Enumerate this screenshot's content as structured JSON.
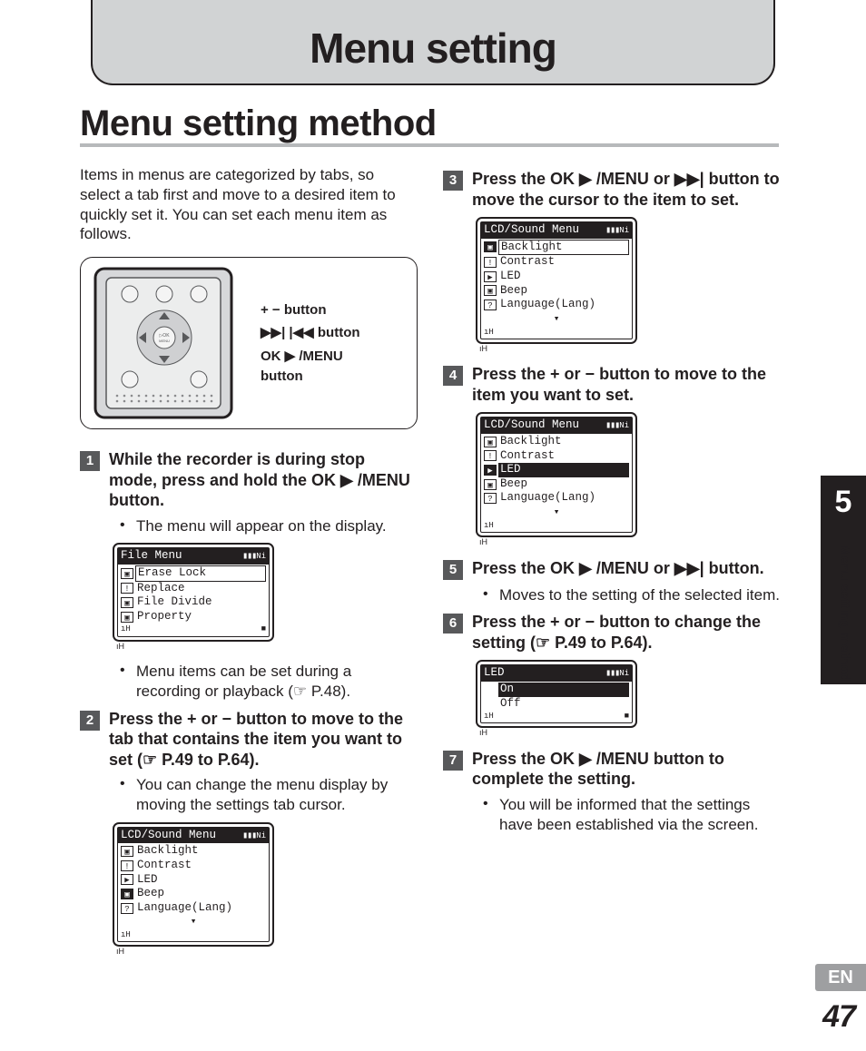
{
  "header": {
    "title": "Menu setting"
  },
  "section_title": "Menu setting method",
  "intro": "Items in menus are categorized by tabs, so select a tab first and move to a desired item to quickly set it. You can set each menu item as follows.",
  "device_labels": {
    "l1a": "+ −",
    "l1b": " button",
    "l2a": "▶▶| |◀◀",
    "l2b": " button",
    "l3a": "OK ▶ /MENU",
    "l3b": "button"
  },
  "steps": {
    "s1": {
      "num": "1",
      "text_a": "While the recorder is during stop mode, press and hold the ",
      "text_b": "OK ▶ /MENU",
      "text_c": " button."
    },
    "s1_b1": "The menu will appear on the display.",
    "s1_b2": "Menu items can be set during a recording or playback (☞ P.48).",
    "s2": {
      "num": "2",
      "text": "Press the + or − button to move to the tab that contains the item you want to set (☞ P.49 to P.64)."
    },
    "s2_b1": "You can change the menu display by moving the settings tab cursor.",
    "s3": {
      "num": "3",
      "text_a": "Press the ",
      "text_b": "OK ▶ /MENU",
      "text_c": " or ",
      "text_d": "▶▶|",
      "text_e": " button to move the cursor to the item to set."
    },
    "s4": {
      "num": "4",
      "text": "Press the + or − button to move to the item you want to set."
    },
    "s5": {
      "num": "5",
      "text_a": "Press the ",
      "text_b": "OK ▶ /MENU",
      "text_c": " or ",
      "text_d": "▶▶|",
      "text_e": " button."
    },
    "s5_b1": "Moves to the setting of the selected item.",
    "s6": {
      "num": "6",
      "text": "Press the + or − button to change the setting (☞ P.49 to P.64)."
    },
    "s7": {
      "num": "7",
      "text_a": "Press the ",
      "text_b": "OK ▶ /MENU",
      "text_c": " button to complete the setting."
    },
    "s7_b1": "You will be informed that the settings have been established via the screen."
  },
  "lcd": {
    "file_menu": {
      "title": "File Menu",
      "rows": [
        {
          "icon": "▣",
          "label": "Erase Lock",
          "mode": "boxed"
        },
        {
          "icon": "!",
          "label": "Replace",
          "mode": ""
        },
        {
          "icon": "▣",
          "label": "File Divide",
          "mode": ""
        },
        {
          "icon": "▣",
          "label": "Property",
          "mode": ""
        }
      ]
    },
    "lcd_sound_1": {
      "title": "LCD/Sound Menu",
      "rows": [
        {
          "icon": "▣",
          "label": "Backlight",
          "mode": ""
        },
        {
          "icon": "!",
          "label": "Contrast",
          "mode": ""
        },
        {
          "icon": "▶",
          "label": "LED",
          "mode": ""
        },
        {
          "icon": "▣",
          "label": "Beep",
          "mode": "sel"
        },
        {
          "icon": "?",
          "label": "Language(Lang)",
          "mode": ""
        }
      ]
    },
    "lcd_sound_2": {
      "title": "LCD/Sound Menu",
      "rows": [
        {
          "icon": "▣",
          "label": "Backlight",
          "mode": "sel boxed"
        },
        {
          "icon": "!",
          "label": "Contrast",
          "mode": ""
        },
        {
          "icon": "▶",
          "label": "LED",
          "mode": ""
        },
        {
          "icon": "▣",
          "label": "Beep",
          "mode": ""
        },
        {
          "icon": "?",
          "label": "Language(Lang)",
          "mode": ""
        }
      ]
    },
    "lcd_sound_3": {
      "title": "LCD/Sound Menu",
      "rows": [
        {
          "icon": "▣",
          "label": "Backlight",
          "mode": ""
        },
        {
          "icon": "!",
          "label": "Contrast",
          "mode": ""
        },
        {
          "icon": "▶",
          "label": "LED",
          "mode": "sel inv"
        },
        {
          "icon": "▣",
          "label": "Beep",
          "mode": ""
        },
        {
          "icon": "?",
          "label": "Language(Lang)",
          "mode": ""
        }
      ]
    },
    "led_menu": {
      "title": "LED",
      "rows": [
        {
          "icon": "",
          "label": "On",
          "mode": "inv"
        },
        {
          "icon": "",
          "label": "Off",
          "mode": ""
        },
        {
          "icon": "",
          "label": " ",
          "mode": ""
        },
        {
          "icon": "",
          "label": " ",
          "mode": ""
        }
      ]
    },
    "batt": "▮▮▮",
    "ni": "Ni",
    "foot_l": "ıH",
    "foot_r": "■"
  },
  "side": {
    "chapter": "5",
    "vtext": "Menu setting method",
    "lang": "EN",
    "page": "47"
  }
}
